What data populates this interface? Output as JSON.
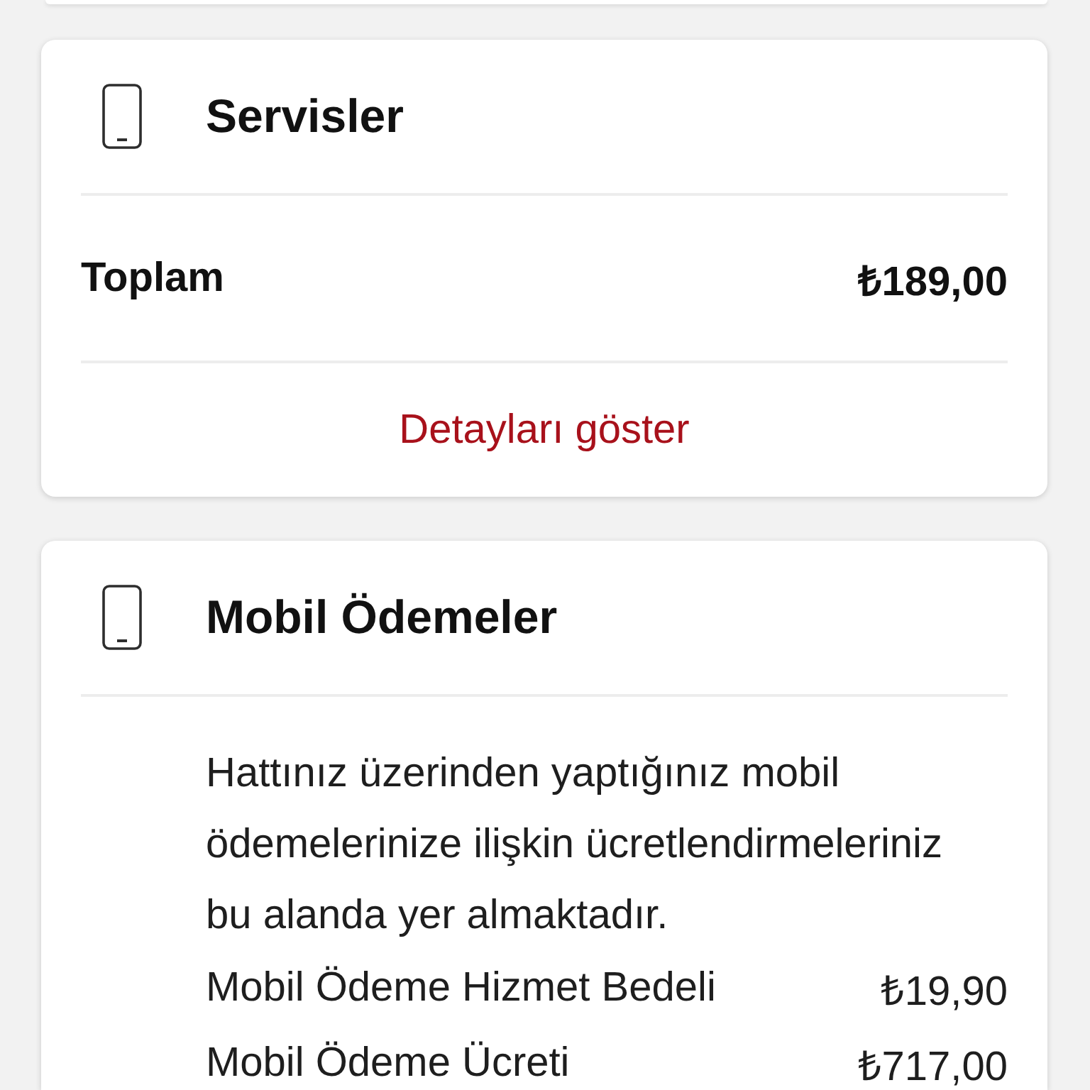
{
  "cards": [
    {
      "title": "Servisler",
      "total": {
        "label": "Toplam",
        "amount": "₺189,00"
      },
      "link": "Detayları göster"
    },
    {
      "title": "Mobil Ödemeler",
      "description": "Hattınız üzerinden yaptığınız mobil ödemelerinize ilişkin ücretlendirmeleriniz bu alanda yer almaktadır.",
      "items": [
        {
          "label": "Mobil Ödeme Hizmet Bedeli",
          "amount": "₺19,90"
        },
        {
          "label": "Mobil Ödeme Ücreti",
          "amount": "₺717,00"
        }
      ]
    }
  ]
}
